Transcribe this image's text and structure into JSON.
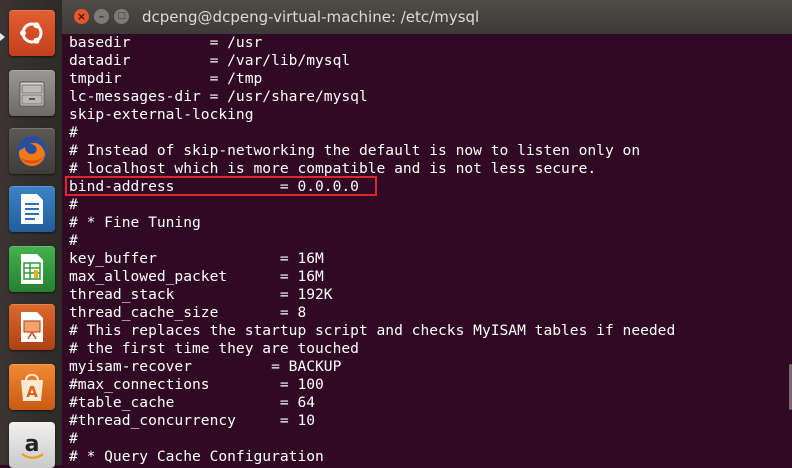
{
  "window": {
    "title": "dcpeng@dcpeng-virtual-machine: /etc/mysql",
    "close_glyph": "×",
    "minimize_glyph": "–",
    "maximize_glyph": "□"
  },
  "launcher": {
    "items": [
      {
        "name": "ubuntu-dash-icon",
        "color": "#d64a27"
      },
      {
        "name": "files-icon",
        "color": "#8a8683"
      },
      {
        "name": "firefox-icon",
        "color": "#e66000"
      },
      {
        "name": "libreoffice-writer-icon",
        "color": "#2a72b5"
      },
      {
        "name": "libreoffice-calc-icon",
        "color": "#2f9c3a"
      },
      {
        "name": "libreoffice-impress-icon",
        "color": "#c8501e"
      },
      {
        "name": "software-center-icon",
        "color": "#e5761f"
      },
      {
        "name": "amazon-icon",
        "color": "#dcdcdc"
      }
    ]
  },
  "terminal": {
    "lines": [
      "basedir         = /usr",
      "datadir         = /var/lib/mysql",
      "tmpdir          = /tmp",
      "lc-messages-dir = /usr/share/mysql",
      "skip-external-locking",
      "#",
      "# Instead of skip-networking the default is now to listen only on",
      "# localhost which is more compatible and is not less secure.",
      "bind-address            = 0.0.0.0",
      "#",
      "# * Fine Tuning",
      "#",
      "key_buffer              = 16M",
      "max_allowed_packet      = 16M",
      "thread_stack            = 192K",
      "thread_cache_size       = 8",
      "# This replaces the startup script and checks MyISAM tables if needed",
      "# the first time they are touched",
      "myisam-recover         = BACKUP",
      "#max_connections        = 100",
      "#table_cache            = 64",
      "#thread_concurrency     = 10",
      "#",
      "# * Query Cache Configuration"
    ],
    "highlight_color": "#e0262e"
  }
}
